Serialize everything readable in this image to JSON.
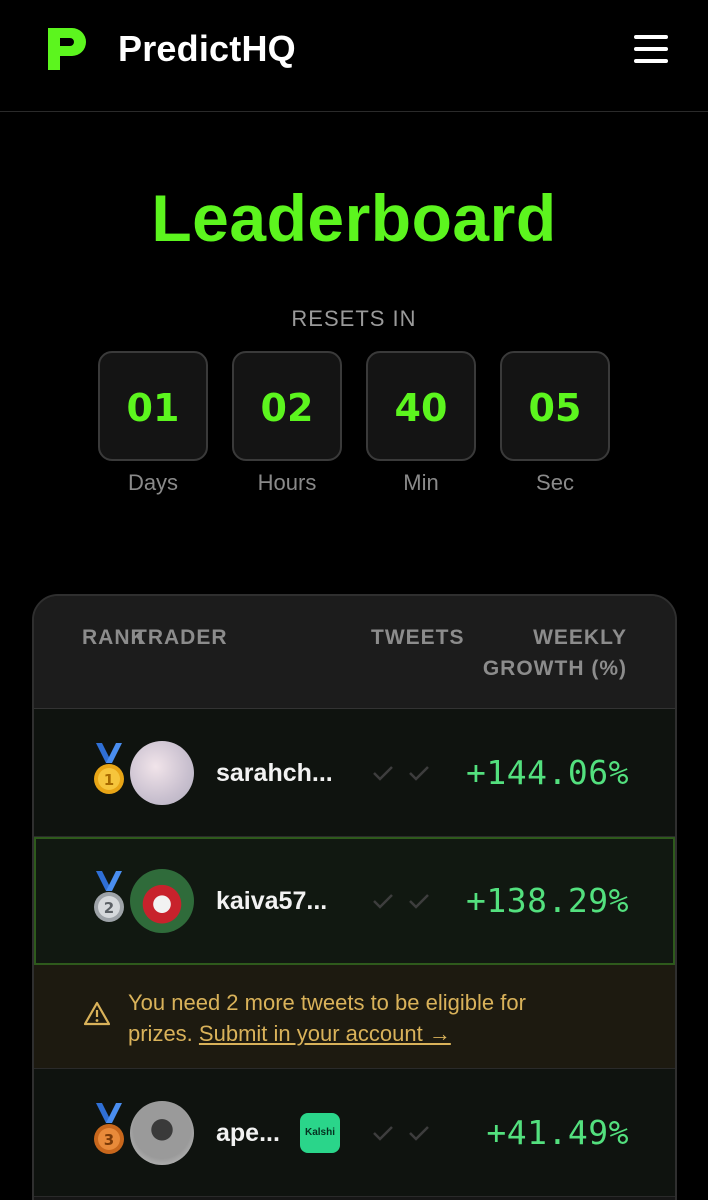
{
  "header": {
    "brand": "PredictHQ",
    "menu_icon": "hamburger-menu-icon"
  },
  "page": {
    "title": "Leaderboard",
    "resets_label": "RESETS IN"
  },
  "countdown": [
    {
      "value": "01",
      "label": "Days"
    },
    {
      "value": "02",
      "label": "Hours"
    },
    {
      "value": "40",
      "label": "Min"
    },
    {
      "value": "05",
      "label": "Sec"
    }
  ],
  "table": {
    "headers": {
      "rank": "RANK",
      "trader": "TRADER",
      "tweets": "TWEETS",
      "growth_line1": "WEEKLY",
      "growth_line2": "GROWTH (%)"
    },
    "rows": [
      {
        "rank": "1",
        "medal": "gold-medal",
        "name": "sarahch...",
        "growth": "+144.06%",
        "badge": ""
      },
      {
        "rank": "2",
        "medal": "silver-medal",
        "name": "kaiva57...",
        "growth": "+138.29%",
        "badge": ""
      },
      {
        "rank": "3",
        "medal": "bronze-medal",
        "name": "ape...",
        "growth": "+41.49%",
        "badge": "Kalshi"
      }
    ],
    "notice": {
      "text": "You need 2 more tweets to be eligible for prizes.",
      "link": "Submit in your account →"
    }
  },
  "colors": {
    "accent": "#5cf51e",
    "growth": "#53e07e",
    "warning": "#d9b25a"
  }
}
